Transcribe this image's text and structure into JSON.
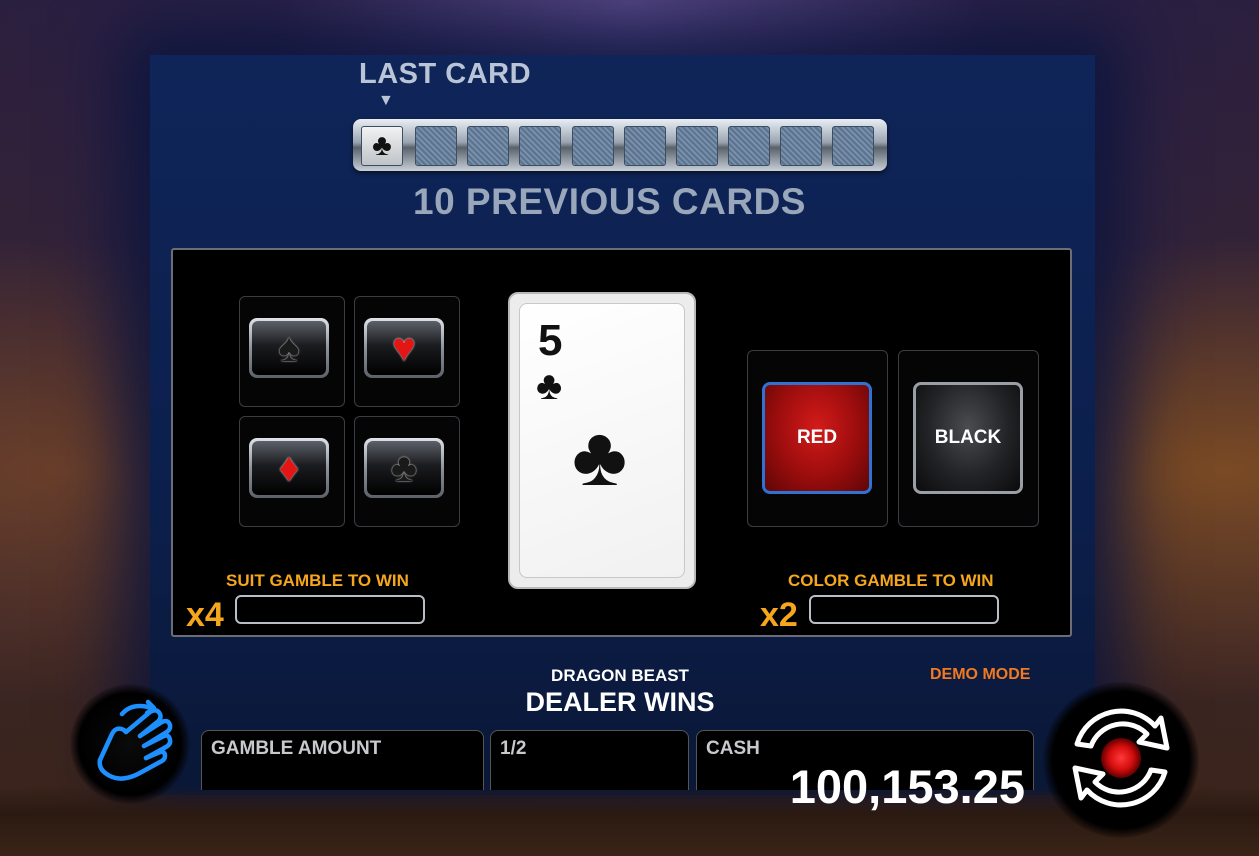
{
  "history": {
    "last_card_label": "LAST CARD",
    "last_card_arrow": "▼",
    "last_card_suit": "♣",
    "hidden_card_count": 9,
    "previous_cards_label": "10 PREVIOUS CARDS"
  },
  "suit_gamble": {
    "buttons": [
      {
        "name": "spade",
        "symbol": "♠",
        "color": "black"
      },
      {
        "name": "heart",
        "symbol": "♥",
        "color": "red"
      },
      {
        "name": "diamond",
        "symbol": "♦",
        "color": "red"
      },
      {
        "name": "club",
        "symbol": "♣",
        "color": "black"
      }
    ],
    "label": "SUIT GAMBLE TO WIN",
    "multiplier": "x4",
    "win_value": ""
  },
  "current_card": {
    "rank": "5",
    "suit": "♣"
  },
  "color_gamble": {
    "red_label": "RED",
    "black_label": "BLACK",
    "label": "COLOR GAMBLE TO WIN",
    "multiplier": "x2",
    "win_value": ""
  },
  "footer": {
    "game_name": "DRAGON BEAST",
    "status": "DEALER WINS",
    "demo_mode": "DEMO MODE",
    "gamble_amount_label": "GAMBLE AMOUNT",
    "gamble_amount_value": "",
    "step_label": "1/2",
    "cash_label": "CASH",
    "cash_value": "100,153.25"
  },
  "colors": {
    "accent_orange": "#f5a61c",
    "demo_orange": "#f07a22",
    "selected_blue": "#2e72d6",
    "red_button": "#b81212",
    "hand_icon_blue": "#1e8fff"
  },
  "icons": [
    "club-icon",
    "spade-icon",
    "heart-icon",
    "diamond-icon",
    "hand-icon",
    "spin-icon"
  ]
}
